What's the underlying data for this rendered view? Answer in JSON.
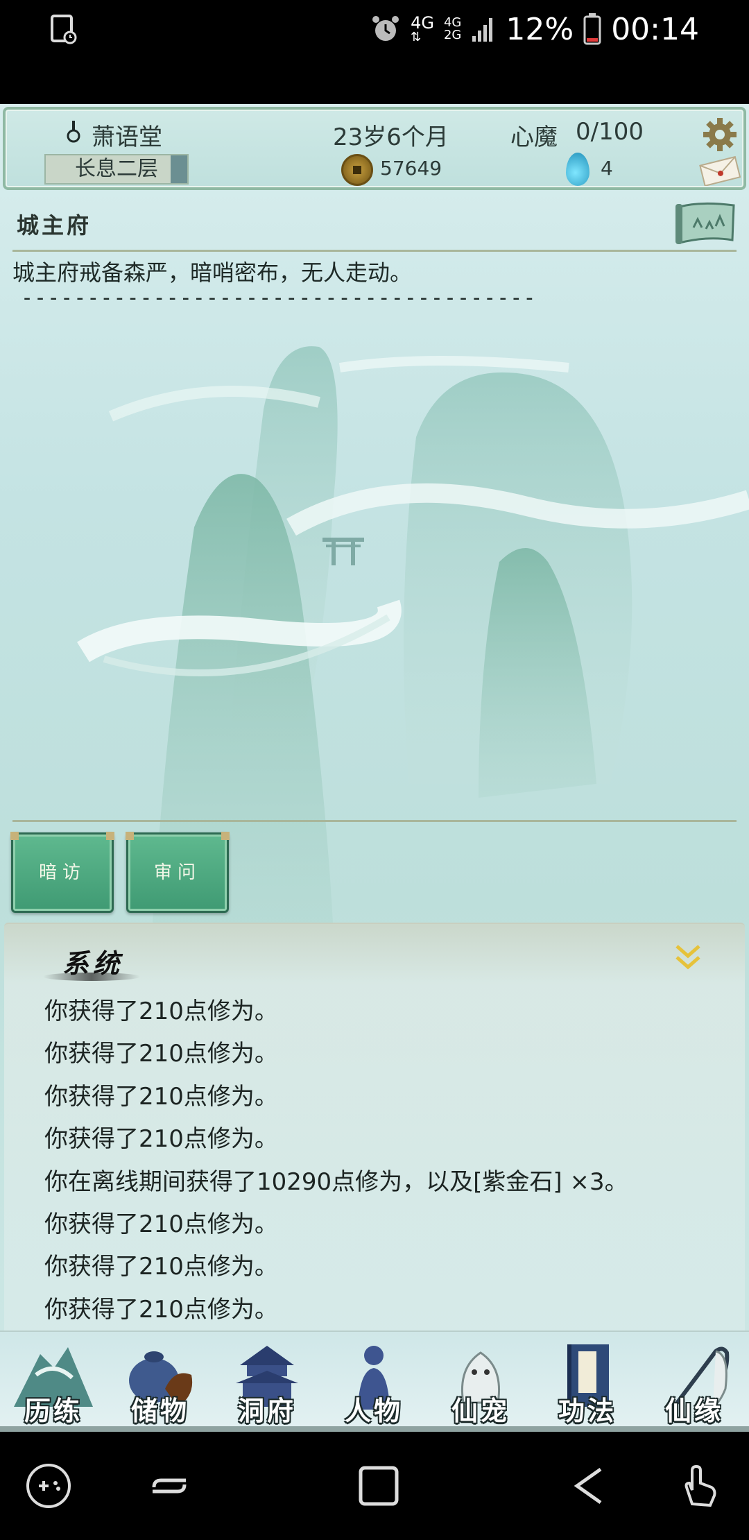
{
  "status_bar": {
    "network_top": "4G",
    "network_bottom": "4G",
    "network_small": "2G",
    "battery": "12%",
    "time": "00:14",
    "icons": [
      "screenshot-icon",
      "alarm-icon",
      "signal-icon",
      "battery-icon"
    ]
  },
  "header": {
    "name": "萧语堂",
    "realm": "长息二层",
    "age": "23岁6个月",
    "heart_demon": "心魔",
    "heart_demon_value": "0/100",
    "coins": "57649",
    "spirit_stones": "4"
  },
  "location": {
    "title": "城主府",
    "description": "城主府戒备森严，暗哨密布，无人走动。",
    "separator": "---------------------------------------"
  },
  "actions": [
    {
      "label": "暗访"
    },
    {
      "label": "审问"
    }
  ],
  "log": {
    "title": "系统",
    "lines": [
      "你获得了210点修为。",
      "你获得了210点修为。",
      "你获得了210点修为。",
      "你获得了210点修为。",
      "你在离线期间获得了10290点修为，以及[紫金石] ×3。",
      "你获得了210点修为。",
      "你获得了210点修为。",
      "你获得了210点修为。"
    ]
  },
  "bottom_nav": [
    {
      "label": "历练",
      "icon": "mountain-icon"
    },
    {
      "label": "储物",
      "icon": "bag-icon"
    },
    {
      "label": "洞府",
      "icon": "pavilion-icon"
    },
    {
      "label": "人物",
      "icon": "person-icon"
    },
    {
      "label": "仙宠",
      "icon": "pet-icon"
    },
    {
      "label": "功法",
      "icon": "book-icon"
    },
    {
      "label": "仙缘",
      "icon": "crane-icon"
    }
  ],
  "colors": {
    "panel_bg": "#c4e3e3",
    "button_green": "#4faa80",
    "border_green": "#8fb9a3"
  }
}
